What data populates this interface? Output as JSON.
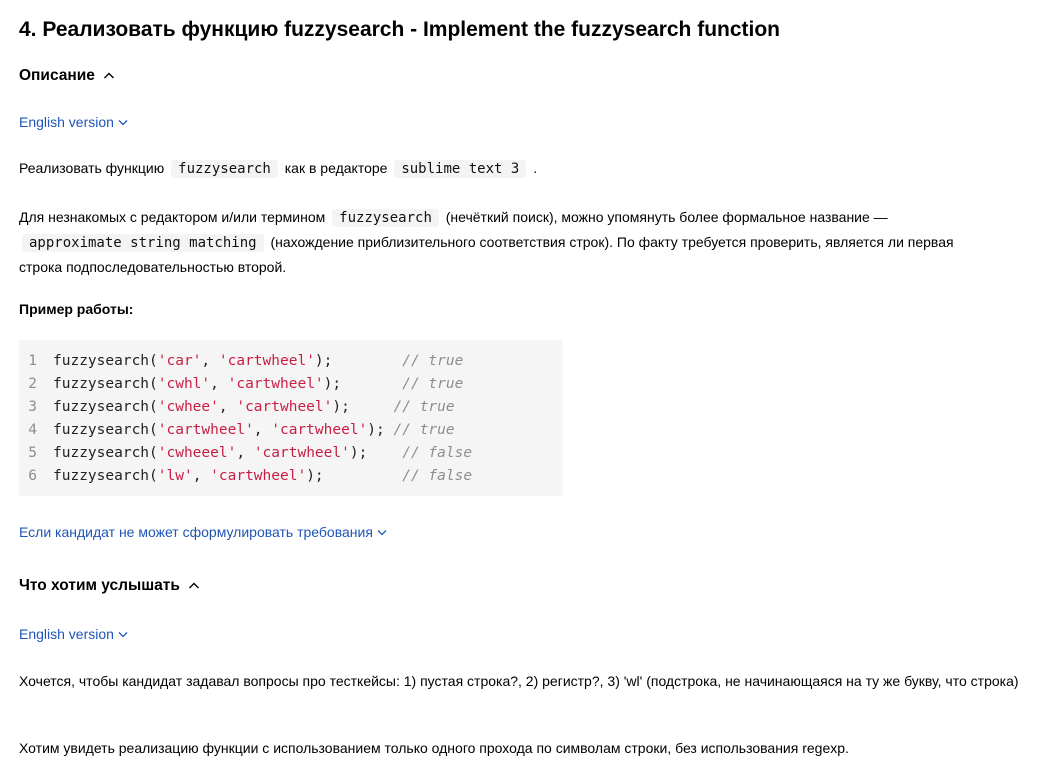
{
  "title": "4. Реализовать функцию fuzzysearch - Implement the fuzzysearch function",
  "description_section": {
    "label": "Описание",
    "english_link": "English version",
    "intro": {
      "before": "Реализовать функцию",
      "code1": "fuzzysearch",
      "middle": "как в редакторе",
      "code2": "sublime text 3",
      "after": "."
    },
    "para2": {
      "part1": "Для незнакомых с редактором и/или термином",
      "code1": "fuzzysearch",
      "part2": "(нечёткий поиск), можно упомянуть более формальное название —",
      "code2": "approximate string matching",
      "part3": "(нахождение приблизительного соответствия строк). По факту требуется проверить, является ли первая строка подпоследовательностью второй."
    },
    "example_heading": "Пример работы:",
    "code_lines": [
      {
        "num": "1",
        "fn": "fuzzysearch(",
        "a1": "'car'",
        "sep": ", ",
        "a2": "'cartwheel'",
        "close": ");",
        "pad": "        ",
        "comment": "// true"
      },
      {
        "num": "2",
        "fn": "fuzzysearch(",
        "a1": "'cwhl'",
        "sep": ", ",
        "a2": "'cartwheel'",
        "close": ");",
        "pad": "       ",
        "comment": "// true"
      },
      {
        "num": "3",
        "fn": "fuzzysearch(",
        "a1": "'cwhee'",
        "sep": ", ",
        "a2": "'cartwheel'",
        "close": ");",
        "pad": "     ",
        "comment": "// true"
      },
      {
        "num": "4",
        "fn": "fuzzysearch(",
        "a1": "'cartwheel'",
        "sep": ", ",
        "a2": "'cartwheel'",
        "close": ");",
        "pad": " ",
        "comment": "// true"
      },
      {
        "num": "5",
        "fn": "fuzzysearch(",
        "a1": "'cwheeel'",
        "sep": ", ",
        "a2": "'cartwheel'",
        "close": ");",
        "pad": "    ",
        "comment": "// false"
      },
      {
        "num": "6",
        "fn": "fuzzysearch(",
        "a1": "'lw'",
        "sep": ", ",
        "a2": "'cartwheel'",
        "close": ");",
        "pad": "         ",
        "comment": "// false"
      }
    ],
    "candidate_link": "Если кандидат не может сформулировать требования"
  },
  "expect_section": {
    "label": "Что хотим услышать",
    "english_link": "English version",
    "para1": "Хочется, чтобы кандидат задавал вопросы про тесткейсы: 1) пустая строка?, 2) регистр?, 3) 'wl' (подстрока, не начинающаяся на ту же букву, что строка)",
    "para2": "Хотим увидеть реализацию функции с использованием только одного прохода по символам строки, без использования regexp."
  },
  "colors": {
    "link": "#1f55b8",
    "string": "#c81e44",
    "comment": "#8e8e8e",
    "code_bg": "#f5f5f5"
  }
}
